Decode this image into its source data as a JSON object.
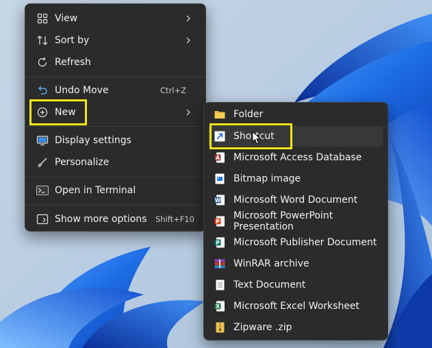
{
  "context_menu": {
    "items": [
      {
        "label": "View",
        "icon": "grid-view-icon",
        "has_submenu": true
      },
      {
        "label": "Sort by",
        "icon": "sort-icon",
        "has_submenu": true
      },
      {
        "label": "Refresh",
        "icon": "refresh-icon"
      },
      {
        "label": "Undo Move",
        "icon": "undo-icon",
        "shortcut": "Ctrl+Z"
      },
      {
        "label": "New",
        "icon": "new-plus-icon",
        "has_submenu": true,
        "highlighted": true
      },
      {
        "label": "Display settings",
        "icon": "display-icon"
      },
      {
        "label": "Personalize",
        "icon": "brush-icon"
      },
      {
        "label": "Open in Terminal",
        "icon": "terminal-icon"
      },
      {
        "label": "Show more options",
        "icon": "more-options-icon",
        "shortcut": "Shift+F10"
      }
    ]
  },
  "new_submenu": {
    "items": [
      {
        "label": "Folder",
        "icon": "folder-icon"
      },
      {
        "label": "Shortcut",
        "icon": "shortcut-icon",
        "highlighted": true
      },
      {
        "label": "Microsoft Access Database",
        "icon": "access-icon"
      },
      {
        "label": "Bitmap image",
        "icon": "bitmap-icon"
      },
      {
        "label": "Microsoft Word Document",
        "icon": "word-icon"
      },
      {
        "label": "Microsoft PowerPoint Presentation",
        "icon": "powerpoint-icon"
      },
      {
        "label": "Microsoft Publisher Document",
        "icon": "publisher-icon"
      },
      {
        "label": "WinRAR archive",
        "icon": "winrar-icon"
      },
      {
        "label": "Text Document",
        "icon": "text-document-icon"
      },
      {
        "label": "Microsoft Excel Worksheet",
        "icon": "excel-icon"
      },
      {
        "label": "Zipware .zip",
        "icon": "zipware-icon"
      }
    ]
  },
  "colors": {
    "menu_background": "#2b2b2b",
    "highlight_box": "#f6e51b",
    "wallpaper_blue": "#1f6fe0"
  }
}
